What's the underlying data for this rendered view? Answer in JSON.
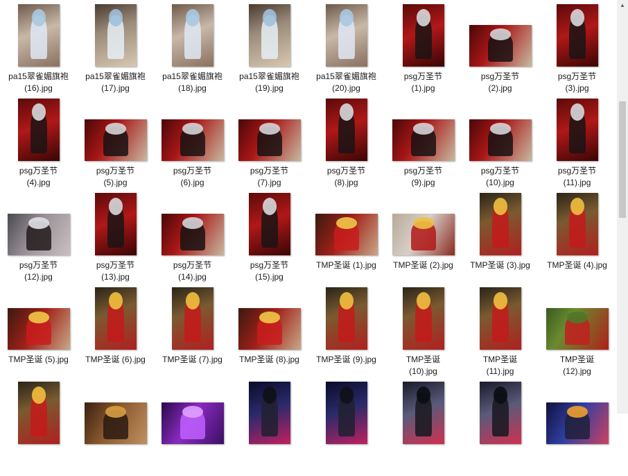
{
  "files": [
    {
      "name1": "pa15翠雀媚旗袍",
      "name2": "(16).jpg",
      "style": "bluehair"
    },
    {
      "name1": "pa15翠雀媚旗袍",
      "name2": "(17).jpg",
      "style": "bluehair2"
    },
    {
      "name1": "pa15翠雀媚旗袍",
      "name2": "(18).jpg",
      "style": "bluehair"
    },
    {
      "name1": "pa15翠雀媚旗袍",
      "name2": "(19).jpg",
      "style": "bluehair2"
    },
    {
      "name1": "pa15翠雀媚旗袍",
      "name2": "(20).jpg",
      "style": "bluehair"
    },
    {
      "name1": "psg万圣节",
      "name2": "(1).jpg",
      "style": "halloween"
    },
    {
      "name1": "psg万圣节",
      "name2": "(2).jpg",
      "style": "halloween-wide"
    },
    {
      "name1": "psg万圣节",
      "name2": "(3).jpg",
      "style": "halloween"
    },
    {
      "name1": "psg万圣节",
      "name2": "(4).jpg",
      "style": "halloween"
    },
    {
      "name1": "psg万圣节",
      "name2": "(5).jpg",
      "style": "halloween-wide"
    },
    {
      "name1": "psg万圣节",
      "name2": "(6).jpg",
      "style": "halloween-wide"
    },
    {
      "name1": "psg万圣节",
      "name2": "(7).jpg",
      "style": "halloween-wide"
    },
    {
      "name1": "psg万圣节",
      "name2": "(8).jpg",
      "style": "halloween"
    },
    {
      "name1": "psg万圣节",
      "name2": "(9).jpg",
      "style": "halloween-wide"
    },
    {
      "name1": "psg万圣节",
      "name2": "(10).jpg",
      "style": "halloween-wide"
    },
    {
      "name1": "psg万圣节",
      "name2": "(11).jpg",
      "style": "halloween"
    },
    {
      "name1": "psg万圣节",
      "name2": "(12).jpg",
      "style": "halloween-wide2"
    },
    {
      "name1": "psg万圣节",
      "name2": "(13).jpg",
      "style": "halloween"
    },
    {
      "name1": "psg万圣节",
      "name2": "(14).jpg",
      "style": "halloween-wide"
    },
    {
      "name1": "psg万圣节",
      "name2": "(15).jpg",
      "style": "halloween"
    },
    {
      "name1": "TMP圣诞 (1).jpg",
      "name2": "",
      "style": "xmas-wide"
    },
    {
      "name1": "TMP圣诞 (2).jpg",
      "name2": "",
      "style": "xmas-wide2"
    },
    {
      "name1": "TMP圣诞 (3).jpg",
      "name2": "",
      "style": "xmas"
    },
    {
      "name1": "TMP圣诞 (4).jpg",
      "name2": "",
      "style": "xmas"
    },
    {
      "name1": "TMP圣诞 (5).jpg",
      "name2": "",
      "style": "xmas-wide"
    },
    {
      "name1": "TMP圣诞 (6).jpg",
      "name2": "",
      "style": "xmas"
    },
    {
      "name1": "TMP圣诞 (7).jpg",
      "name2": "",
      "style": "xmas"
    },
    {
      "name1": "TMP圣诞 (8).jpg",
      "name2": "",
      "style": "xmas-wide"
    },
    {
      "name1": "TMP圣诞 (9).jpg",
      "name2": "",
      "style": "xmas"
    },
    {
      "name1": "TMP圣诞",
      "name2": "(10).jpg",
      "style": "xmas"
    },
    {
      "name1": "TMP圣诞",
      "name2": "(11).jpg",
      "style": "xmas"
    },
    {
      "name1": "TMP圣诞",
      "name2": "(12).jpg",
      "style": "xmas-wide3"
    },
    {
      "name1": "",
      "name2": "",
      "style": "xmas"
    },
    {
      "name1": "",
      "name2": "",
      "style": "bar-wide"
    },
    {
      "name1": "",
      "name2": "",
      "style": "purple-wide"
    },
    {
      "name1": "",
      "name2": "",
      "style": "neon"
    },
    {
      "name1": "",
      "name2": "",
      "style": "neon"
    },
    {
      "name1": "",
      "name2": "",
      "style": "neon2"
    },
    {
      "name1": "",
      "name2": "",
      "style": "neon2"
    },
    {
      "name1": "",
      "name2": "",
      "style": "neon-wide"
    }
  ],
  "palette": {
    "bluehair": {
      "bg": "linear-gradient(160deg,#6e5a4a,#c8b8a8 45%,#8a7060)",
      "fig": "#dfe8f4",
      "hair": "#a9c8e0"
    },
    "bluehair2": {
      "bg": "linear-gradient(160deg,#4a3a30,#9a8a7a 40%,#d8c8b0)",
      "fig": "#e6eef6",
      "hair": "#9fc0dc"
    },
    "halloween": {
      "bg": "linear-gradient(160deg,#5a0a0a,#b01818 45%,#3a0505)",
      "fig": "#1a1414",
      "hair": "#d8d8dc"
    },
    "halloween-wide": {
      "bg": "linear-gradient(120deg,#4a0808,#a81616 40%,#c8b8a0)",
      "fig": "#181212",
      "hair": "#d4d4d8"
    },
    "halloween-wide2": {
      "bg": "linear-gradient(120deg,#4a4a50,#9a9098 45%,#c8c0c0)",
      "fig": "#221a1a",
      "hair": "#e0e0e4"
    },
    "xmas": {
      "bg": "linear-gradient(160deg,#2a2418,#7a5a30 40%,#b02020)",
      "fig": "#c41a1a",
      "hair": "#f0c040"
    },
    "xmas-wide": {
      "bg": "linear-gradient(120deg,#3a1a10,#a02018 45%,#c8a888)",
      "fig": "#c81c1c",
      "hair": "#f0c848"
    },
    "xmas-wide2": {
      "bg": "linear-gradient(120deg,#b8a898,#d8d0c8 45%,#8a2a20)",
      "fig": "#b01818",
      "hair": "#f0c040"
    },
    "xmas-wide3": {
      "bg": "linear-gradient(120deg,#3a5a20,#6a8a30 35%,#b02018)",
      "fig": "#c02020",
      "hair": "#4a7a28"
    },
    "bar-wide": {
      "bg": "linear-gradient(120deg,#3a2010,#8a5a30 45%,#c09060)",
      "fig": "#2a1a10",
      "hair": "#d8a040"
    },
    "purple-wide": {
      "bg": "linear-gradient(120deg,#2a0a4a,#8a2ac0 45%,#3a1060)",
      "fig": "#c060ff",
      "hair": "#e0a0ff"
    },
    "neon": {
      "bg": "linear-gradient(160deg,#0a0a2a,#2a2a6a 45%,#c02060)",
      "fig": "#202030",
      "hair": "#101018"
    },
    "neon2": {
      "bg": "linear-gradient(160deg,#1a1a2a,#5a5a7a 45%,#d03050)",
      "fig": "#181820",
      "hair": "#0c0c14"
    },
    "neon-wide": {
      "bg": "linear-gradient(120deg,#101040,#3040a0 45%,#d04060)",
      "fig": "#202038",
      "hair": "#f0a030"
    }
  }
}
